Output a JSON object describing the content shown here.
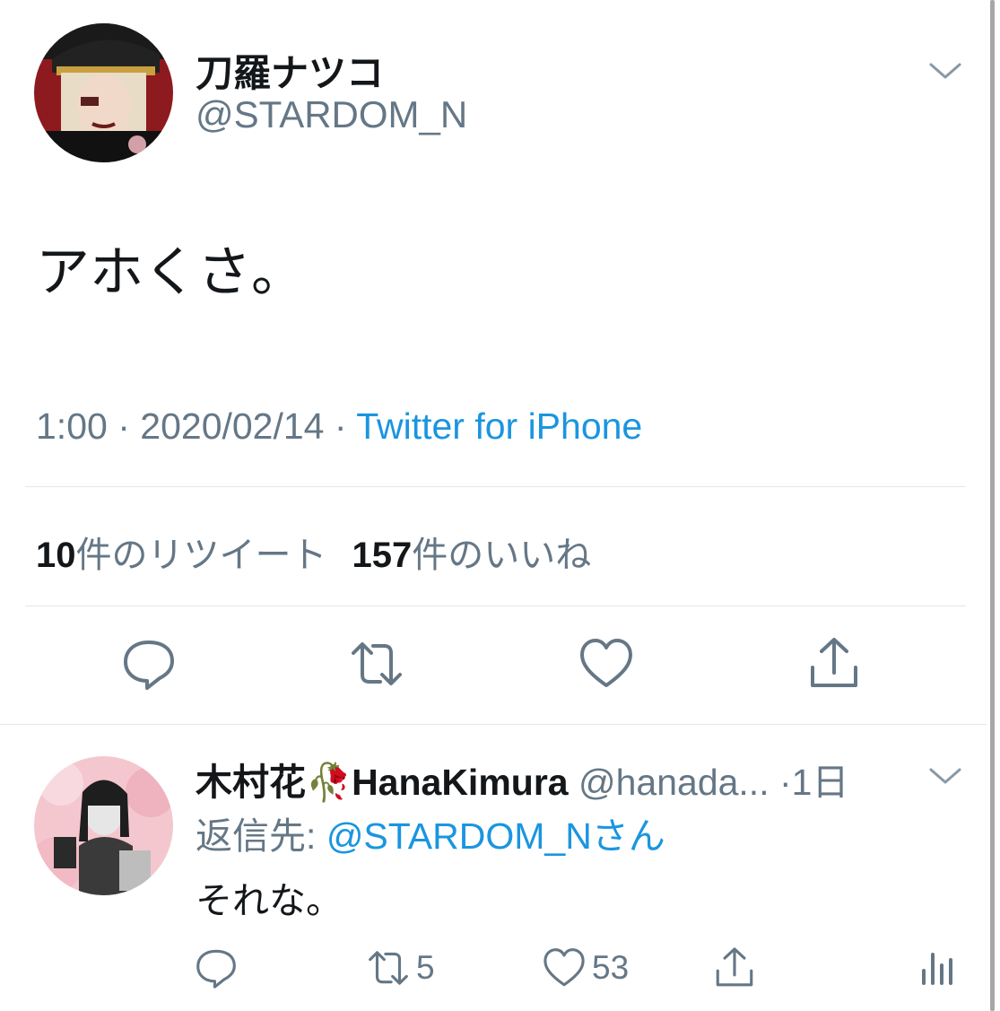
{
  "tweet": {
    "display_name": "刀羅ナツコ",
    "handle": "@STARDOM_N",
    "text": "アホくさ。",
    "time": "1:00",
    "date": "2020/02/14",
    "source": "Twitter for iPhone",
    "separator": "·",
    "retweet_count": "10",
    "retweet_label": "件のリツイート",
    "like_count": "157",
    "like_label": "件のいいね"
  },
  "reply": {
    "display_name": "木村花",
    "display_name_suffix": "HanaKimura",
    "name_emoji": "🥀",
    "handle": "@hanada...",
    "time": "·1日",
    "reply_to_label": "返信先:",
    "reply_to_mention": "@STARDOM_Nさん",
    "text": "それな。",
    "retweet_count": "5",
    "like_count": "53"
  },
  "icons": {
    "caret": "chevron-down-icon",
    "reply": "reply-icon",
    "retweet": "retweet-icon",
    "like": "heart-icon",
    "share": "share-icon",
    "analytics": "analytics-icon"
  },
  "colors": {
    "link": "#1b95e0",
    "muted": "#657786",
    "text": "#14171a",
    "divider": "#e1e8ed"
  }
}
